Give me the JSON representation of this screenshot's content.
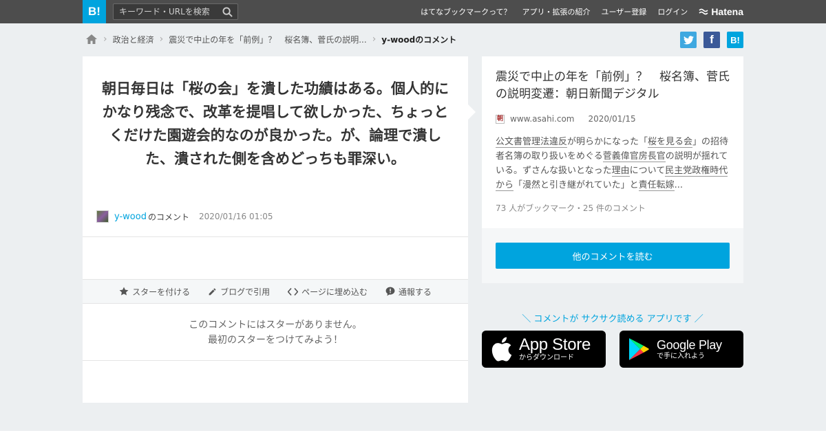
{
  "header": {
    "logo": "B!",
    "search_placeholder": "キーワード・URLを検索",
    "nav": [
      "はてなブックマークって？",
      "アプリ・拡張の紹介",
      "ユーザー登録",
      "ログイン"
    ],
    "brand": "Hatena"
  },
  "breadcrumb": {
    "items": [
      "政治と経済",
      "震災で中止の年を「前例」？　桜名簿、菅氏の説明...",
      "y-woodのコメント"
    ]
  },
  "share": {
    "bookmark_label": "B!"
  },
  "comment": {
    "text": "朝日毎日は「桜の会」を潰した功績はある。個人的にかなり残念で、改革を提唱して欲しかった、ちょっとくだけた園遊会的なのが良かった。が、論理で潰した、潰された側を含めどっちも罪深い。",
    "user": "y-wood",
    "user_suffix": "のコメント",
    "date": "2020/01/16 01:05"
  },
  "actions": {
    "star": "スターを付ける",
    "blog": "ブログで引用",
    "embed": "ページに埋め込む",
    "report": "通報する"
  },
  "no_star": {
    "line1": "このコメントにはスターがありません。",
    "line2": "最初のスターをつけてみよう！"
  },
  "entry": {
    "title": "震災で中止の年を「前例」？　桜名簿、菅氏の説明変遷：朝日新聞デジタル",
    "favicon": "朝",
    "domain": "www.asahi.com",
    "date": "2020/01/15",
    "desc": {
      "a1": "公文書管理法違反",
      "t1": "が明らかになった「",
      "a2": "桜を見る会",
      "t2": "」の招待者名簿の取り扱いをめぐる",
      "a3": "菅義偉",
      "a4": "官房長官",
      "t3": "の説明が揺れている。ずさんな扱いとなった",
      "a5": "理由",
      "t4": "について",
      "a6": "民主党政権時代から",
      "t5": "「漫然と引き継がれていた」と",
      "a7": "責任転嫁",
      "t6": "..."
    },
    "counts": "73 人がブックマーク・25 件のコメント",
    "more_button": "他のコメントを読む"
  },
  "promo": {
    "text": "＼ コメントが サクサク読める アプリです ／",
    "appstore_small": "からダウンロード",
    "appstore_big": "App Store",
    "googleplay_big": "Google Play",
    "googleplay_small": "で手に入れよう"
  },
  "colors": {
    "accent": "#00a4de",
    "header_bg": "#4d4d4d",
    "twitter": "#1da1f2",
    "facebook": "#3b5998"
  }
}
